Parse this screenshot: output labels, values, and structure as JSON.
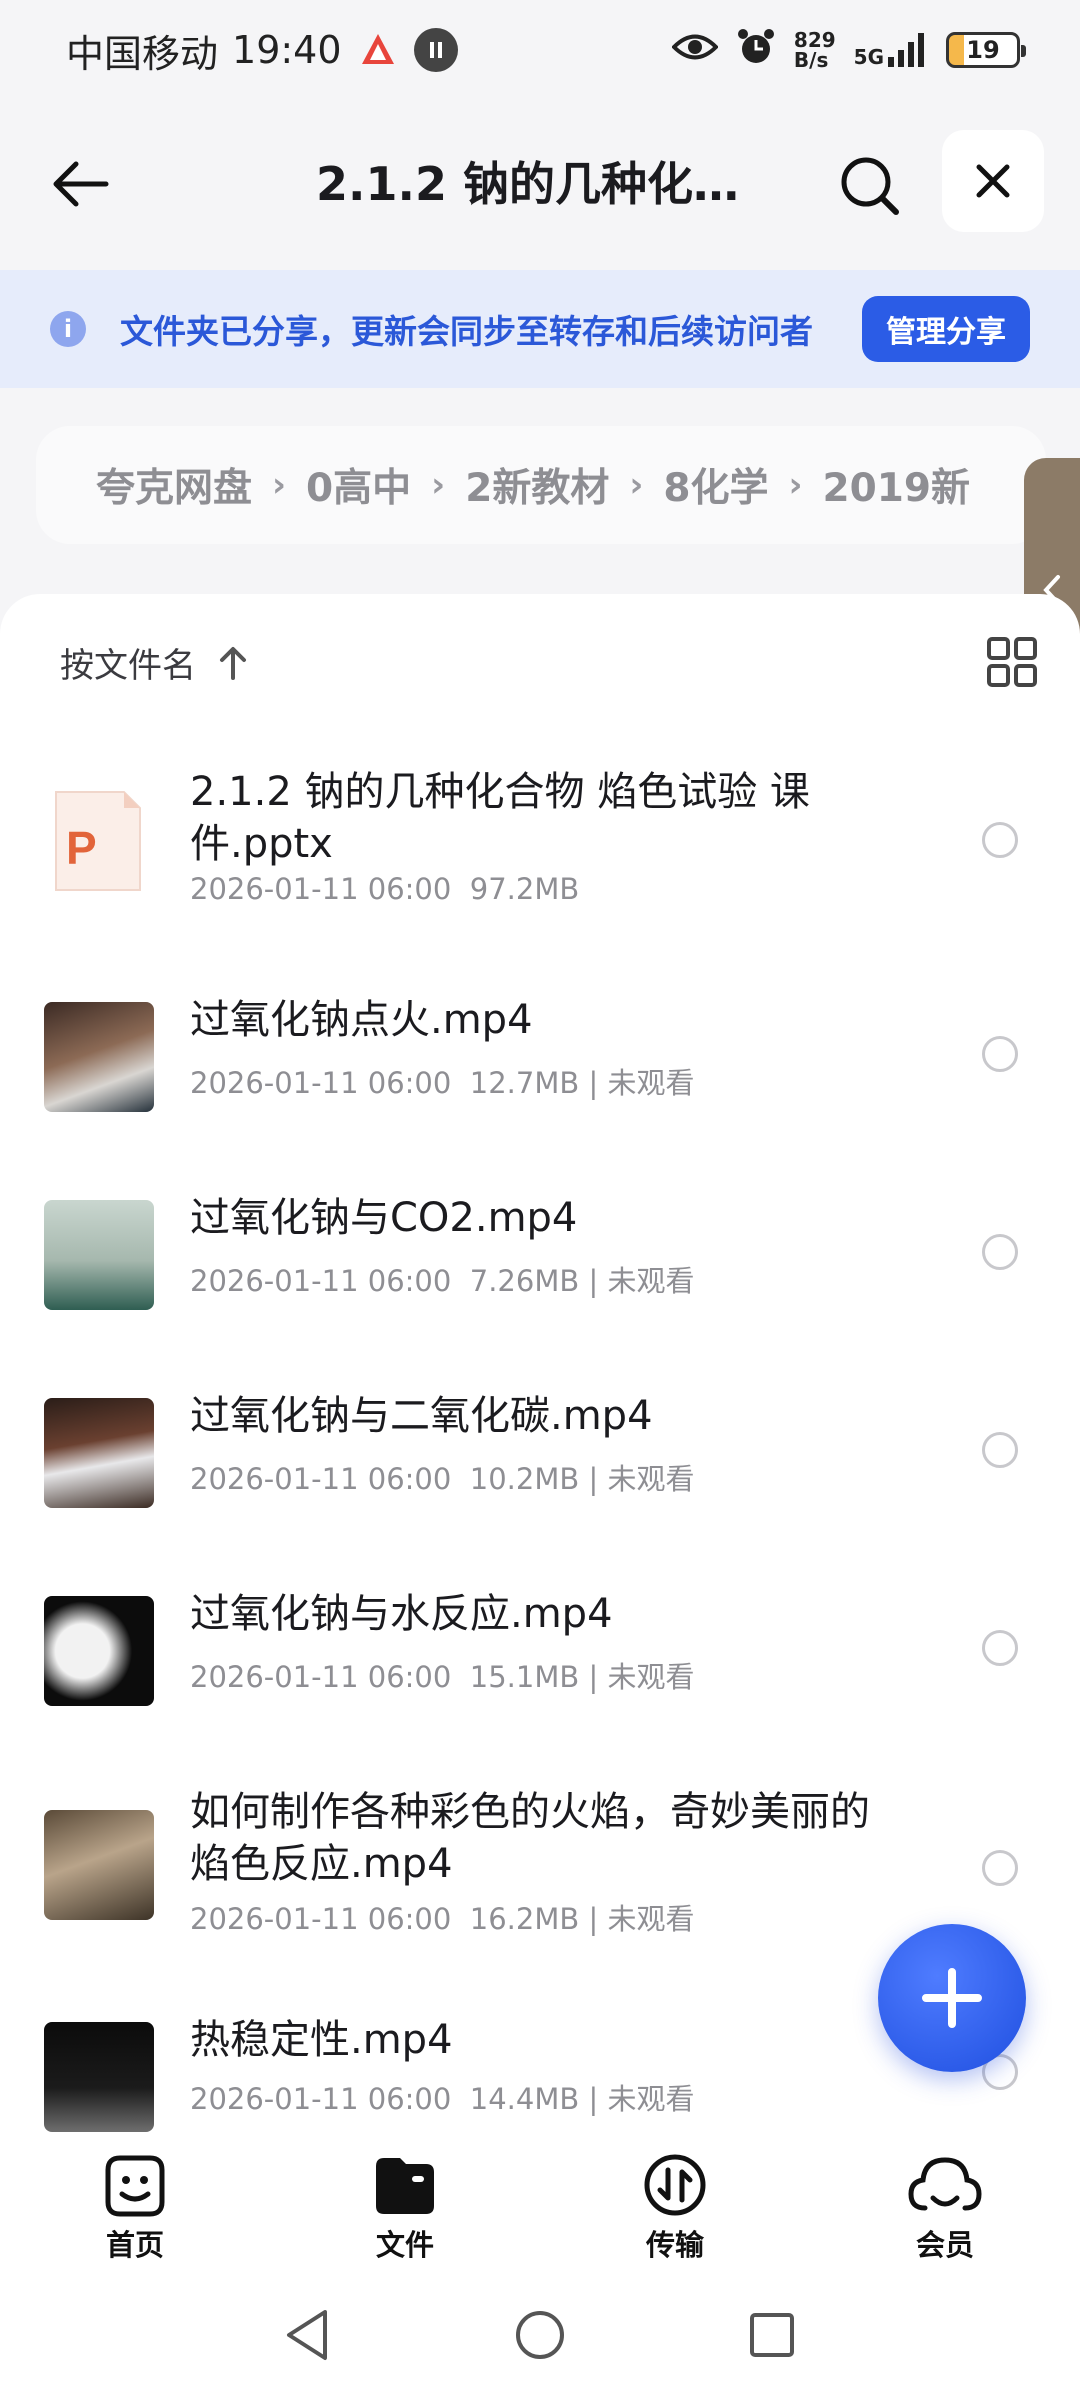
{
  "status_bar": {
    "carrier": "中国移动",
    "time": "19:40",
    "net_speed_value": "829",
    "net_speed_unit": "B/s",
    "signal": "5G",
    "battery": "19"
  },
  "header": {
    "title": "2.1.2 钠的几种化合...",
    "back_icon": "arrow-left-icon",
    "search_icon": "search-icon",
    "close_icon": "close-icon"
  },
  "share_banner": {
    "text": "文件夹已分享，更新会同步至转存和后续访问者",
    "button": "管理分享"
  },
  "breadcrumb": {
    "items": [
      "夸克网盘",
      "0高中",
      "2新教材",
      "8化学",
      "2019新"
    ]
  },
  "sort": {
    "label": "按文件名",
    "direction_icon": "arrow-up-icon"
  },
  "files": [
    {
      "name": "2.1.2  钠的几种化合物  焰色试验 课件.pptx",
      "date": "2026-01-11 06:00",
      "size": "97.2MB",
      "status": ""
    },
    {
      "name": "过氧化钠点火.mp4",
      "date": "2026-01-11 06:00",
      "size": "12.7MB",
      "status": "未观看"
    },
    {
      "name": "过氧化钠与CO2.mp4",
      "date": "2026-01-11 06:00",
      "size": "7.26MB",
      "status": "未观看"
    },
    {
      "name": "过氧化钠与二氧化碳.mp4",
      "date": "2026-01-11 06:00",
      "size": "10.2MB",
      "status": "未观看"
    },
    {
      "name": "过氧化钠与水反应.mp4",
      "date": "2026-01-11 06:00",
      "size": "15.1MB",
      "status": "未观看"
    },
    {
      "name": "如何制作各种彩色的火焰，奇妙美丽的焰色反应.mp4",
      "date": "2026-01-11 06:00",
      "size": "16.2MB",
      "status": "未观看"
    },
    {
      "name": "热稳定性.mp4",
      "date": "2026-01-11 06:00",
      "size": "14.4MB",
      "status": "未观看"
    }
  ],
  "meta_separator": "|",
  "bottom_nav": [
    {
      "label": "首页",
      "icon": "home-face-icon"
    },
    {
      "label": "文件",
      "icon": "folder-icon"
    },
    {
      "label": "传输",
      "icon": "transfer-icon"
    },
    {
      "label": "会员",
      "icon": "cloud-icon"
    }
  ],
  "colors": {
    "accent": "#2b5ce6",
    "banner_bg": "#e6ecfb",
    "banner_text": "#2b58d8"
  }
}
